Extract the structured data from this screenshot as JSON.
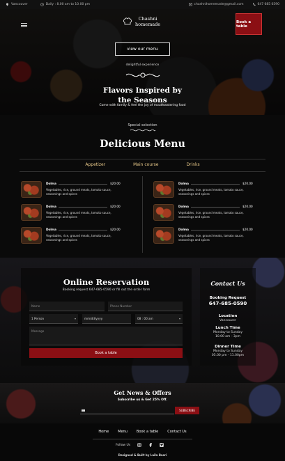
{
  "topbar": {
    "location": "Vancouver",
    "hours": "Daily : 8.00 am to 10.00 pm",
    "email": "chashnihomemade@gmail.com",
    "phone": "647 685 0590",
    "icons": [
      "location-pin-icon",
      "clock-icon",
      "mail-icon",
      "phone-icon"
    ]
  },
  "header": {
    "logo_line1": "Chashni",
    "logo_line2": "homemade",
    "book_badge": "Book a table",
    "view_menu": "view our menu"
  },
  "hero": {
    "tagline": "delightful experience",
    "title_line1": "Flavors Inspired by",
    "title_line2": "the Seasons",
    "subtitle": "Come with family & feel the joy of mouthwatering food"
  },
  "menu": {
    "special": "Special selection",
    "title": "Delicious Menu",
    "tabs": [
      "Appetizer",
      "Main course",
      "Drinks"
    ],
    "left": [
      {
        "name": "Dolma",
        "price": "$20.00",
        "desc": "Vegetables, rice, ground meats, tomato sauce, seasonings and spices"
      },
      {
        "name": "Dolma",
        "price": "$20.00",
        "desc": "Vegetables, rice, ground meats, tomato sauce, seasonings and spices"
      },
      {
        "name": "Dolma",
        "price": "$20.00",
        "desc": "Vegetables, rice, ground meats, tomato sauce, seasonings and spices"
      }
    ],
    "right": [
      {
        "name": "Dolma",
        "price": "$20.00",
        "desc": "Vegetables, rice, ground meats, tomato sauce, seasonings and spices"
      },
      {
        "name": "Dolma",
        "price": "$20.00",
        "desc": "Vegetables, rice, ground meats, tomato sauce, seasonings and spices"
      },
      {
        "name": "Dolma",
        "price": "$20.00",
        "desc": "Vegetables, rice, ground meats, tomato sauce, seasonings and spices"
      }
    ]
  },
  "reservation": {
    "title": "Online Reservation",
    "subtitle": "Booking request 647-685-0590 or fill out the order form",
    "name_placeholder": "Name",
    "phone_placeholder": "Phone Number",
    "persons_value": "1 Person",
    "date_value": "mm/dd/yyyy",
    "time_value": "08 : 00 am",
    "message_placeholder": "Message",
    "book_button": "Book a table"
  },
  "contact": {
    "title": "Contact Us",
    "booking_label": "Booking Request",
    "booking_phone": "647-685-0590",
    "location_label": "Location",
    "location_value": "Vancouver",
    "lunch_label": "Lunch Time",
    "lunch_days": "Monday to Sunday",
    "lunch_hours": "10.00 am - 3pm",
    "dinner_label": "Dinner Time",
    "dinner_days": "Monday to Sunday",
    "dinner_hours": "05.00 pm - 11.00pm"
  },
  "newsletter": {
    "title": "Get News & Offers",
    "subtitle": "Subscribe us & Get 25% Off.",
    "input_placeholder": "",
    "subscribe_button": "SUBSCRIBE"
  },
  "footer": {
    "nav": [
      "Home",
      "Menu",
      "Book a table",
      "Contact Us"
    ],
    "follow": "Follow Us",
    "social_icons": [
      "instagram-icon",
      "facebook-icon",
      "twitter-icon"
    ],
    "credit": "Designed & Built by Laila Basri"
  },
  "colors": {
    "accent": "#8b0f14",
    "tab_text": "#e8c98a",
    "background": "#0b0b0b"
  }
}
